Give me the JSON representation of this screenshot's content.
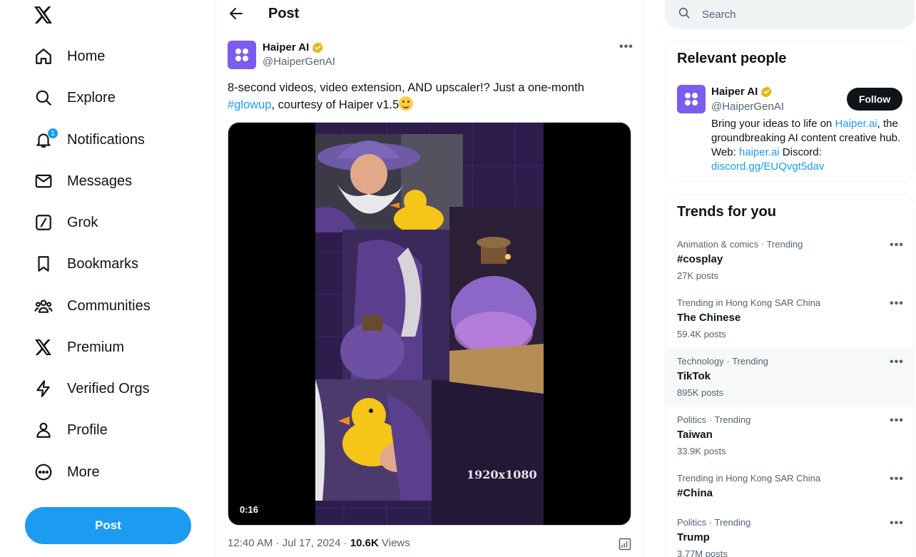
{
  "nav": {
    "logo": "x-logo-icon",
    "items": [
      {
        "label": "Home",
        "icon": "home-icon"
      },
      {
        "label": "Explore",
        "icon": "search-icon"
      },
      {
        "label": "Notifications",
        "icon": "bell-icon",
        "badge": "1"
      },
      {
        "label": "Messages",
        "icon": "envelope-icon"
      },
      {
        "label": "Grok",
        "icon": "grok-icon"
      },
      {
        "label": "Bookmarks",
        "icon": "bookmark-icon"
      },
      {
        "label": "Communities",
        "icon": "people-icon"
      },
      {
        "label": "Premium",
        "icon": "x-logo-icon"
      },
      {
        "label": "Verified Orgs",
        "icon": "lightning-icon"
      },
      {
        "label": "Profile",
        "icon": "person-icon"
      },
      {
        "label": "More",
        "icon": "more-circle-icon"
      }
    ],
    "post_button": "Post"
  },
  "main": {
    "header_title": "Post",
    "post": {
      "author_name": "Haiper AI",
      "author_handle": "@HaiperGenAI",
      "text_before": "8-second videos, video extension, AND upscaler!? Just a one-month ",
      "hashtag": "#glowup",
      "text_after": ", courtesy of Haiper v1.5",
      "media": {
        "duration": "0:16",
        "resolution_label": "1920x1080"
      },
      "time": "12:40 AM",
      "date": "Jul 17, 2024",
      "views_count": "10.6K",
      "views_label": "Views"
    }
  },
  "sidebar": {
    "search_placeholder": "Search",
    "relevant_people": {
      "title": "Relevant people",
      "name": "Haiper AI",
      "handle": "@HaiperGenAI",
      "follow_label": "Follow",
      "bio": {
        "part1": "Bring your ideas to life on ",
        "link1": "Haiper.ai",
        "part2": ", the groundbreaking AI content creative hub. Web: ",
        "link2": "haiper.ai",
        "part3": " Discord: ",
        "link3": "discord.gg/EUQvgt5dav"
      }
    },
    "trends": {
      "title": "Trends for you",
      "items": [
        {
          "category": "Animation & comics · Trending",
          "name": "#cosplay",
          "count": "27K posts"
        },
        {
          "category": "Trending in Hong Kong SAR China",
          "name": "The Chinese",
          "count": "59.4K posts"
        },
        {
          "category": "Technology · Trending",
          "name": "TikTok",
          "count": "895K posts"
        },
        {
          "category": "Politics · Trending",
          "name": "Taiwan",
          "count": "33.9K posts"
        },
        {
          "category": "Trending in Hong Kong SAR China",
          "name": "#China",
          "count": ""
        },
        {
          "category": "Politics · Trending",
          "name": "Trump",
          "count": "3.77M posts"
        }
      ]
    }
  },
  "colors": {
    "accent": "#1d9bf0",
    "text": "#0f1419",
    "muted": "#536471",
    "avatar": "#7a5cf0",
    "verified_gold": "#e2b719"
  }
}
